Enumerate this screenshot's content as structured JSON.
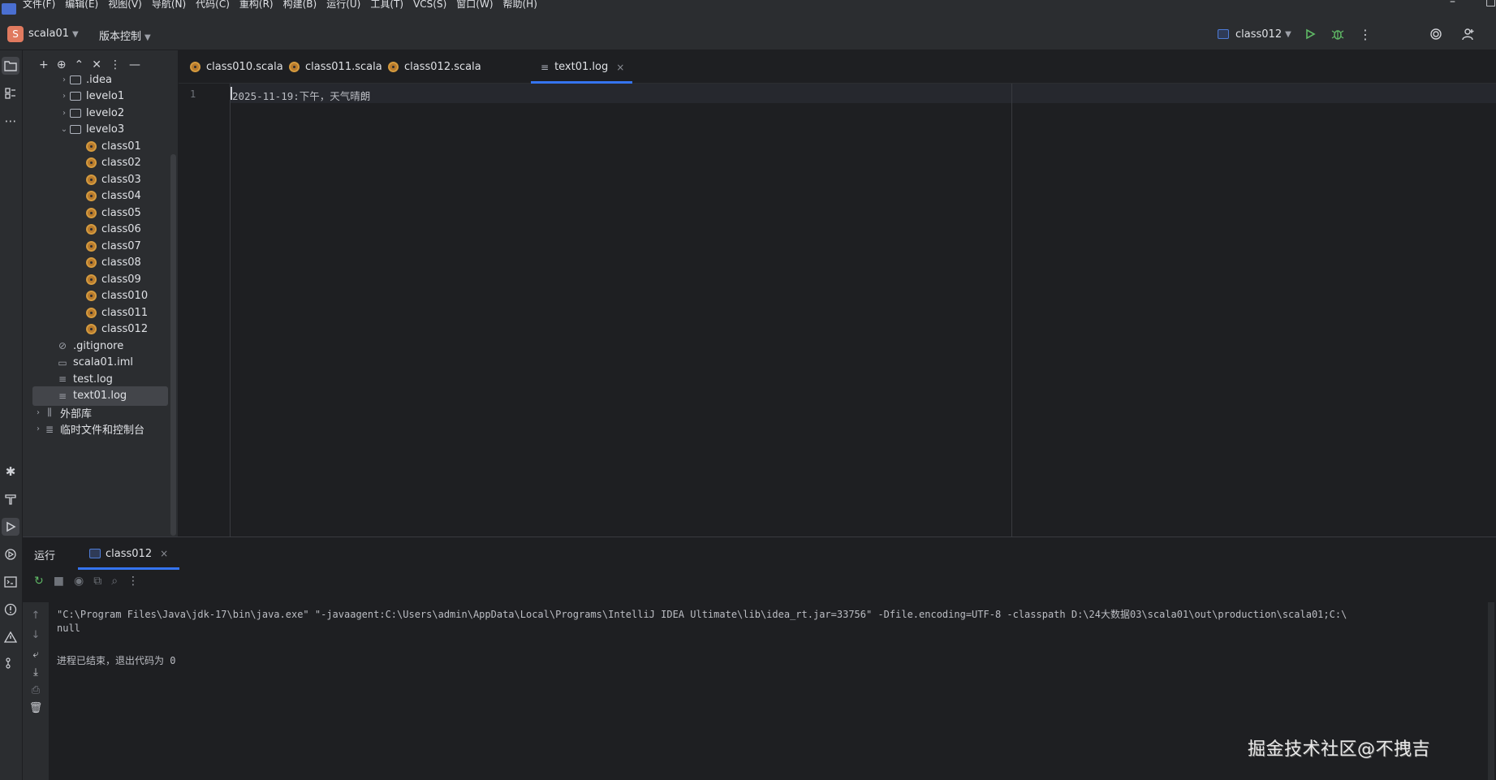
{
  "menu": [
    "文件(F)",
    "编辑(E)",
    "视图(V)",
    "导航(N)",
    "代码(C)",
    "重构(R)",
    "构建(B)",
    "运行(U)",
    "工具(T)",
    "VCS(S)",
    "窗口(W)",
    "帮助(H)"
  ],
  "toolbar": {
    "project_badge": "S",
    "project_name": "scala01",
    "vcs_label": "版本控制",
    "run_config": "class012",
    "icons": [
      "run-icon",
      "debug-icon",
      "more-icon",
      "ai-icon",
      "add-user-icon"
    ]
  },
  "project_tree": {
    "items": [
      {
        "label": ".idea",
        "indent": 1,
        "kind": "folder",
        "expanded": false
      },
      {
        "label": "levelo1",
        "indent": 1,
        "kind": "package",
        "expanded": false
      },
      {
        "label": "levelo2",
        "indent": 1,
        "kind": "package",
        "expanded": false
      },
      {
        "label": "levelo3",
        "indent": 1,
        "kind": "package",
        "expanded": true
      },
      {
        "label": "class01",
        "indent": 2,
        "kind": "scala"
      },
      {
        "label": "class02",
        "indent": 2,
        "kind": "scala"
      },
      {
        "label": "class03",
        "indent": 2,
        "kind": "scala"
      },
      {
        "label": "class04",
        "indent": 2,
        "kind": "scala"
      },
      {
        "label": "class05",
        "indent": 2,
        "kind": "scala"
      },
      {
        "label": "class06",
        "indent": 2,
        "kind": "scala"
      },
      {
        "label": "class07",
        "indent": 2,
        "kind": "scala"
      },
      {
        "label": "class08",
        "indent": 2,
        "kind": "scala"
      },
      {
        "label": "class09",
        "indent": 2,
        "kind": "scala"
      },
      {
        "label": "class010",
        "indent": 2,
        "kind": "scala"
      },
      {
        "label": "class011",
        "indent": 2,
        "kind": "scala"
      },
      {
        "label": "class012",
        "indent": 2,
        "kind": "scala"
      },
      {
        "label": ".gitignore",
        "indent": 0,
        "kind": "ignore"
      },
      {
        "label": "scala01.iml",
        "indent": 0,
        "kind": "iml"
      },
      {
        "label": "test.log",
        "indent": 0,
        "kind": "log"
      },
      {
        "label": "text01.log",
        "indent": 0,
        "kind": "log",
        "selected": true
      },
      {
        "label": "外部库",
        "indent": -1,
        "kind": "library",
        "expanded": false
      },
      {
        "label": "临时文件和控制台",
        "indent": -1,
        "kind": "scratch",
        "expanded": false
      }
    ]
  },
  "tabs": [
    {
      "label": "class010.scala",
      "kind": "scala"
    },
    {
      "label": "class011.scala",
      "kind": "scala"
    },
    {
      "label": "class012.scala",
      "kind": "scala"
    },
    {
      "label": "text01.log",
      "kind": "log",
      "active": true,
      "close": "×"
    }
  ],
  "editor": {
    "line_number": "1",
    "line_text": "2025-11-19:下午，天气晴朗"
  },
  "run_panel": {
    "title": "运行",
    "tab_label": "class012",
    "tab_close": "×",
    "console": [
      "\"C:\\Program Files\\Java\\jdk-17\\bin\\java.exe\" \"-javaagent:C:\\Users\\admin\\AppData\\Local\\Programs\\IntelliJ IDEA Ultimate\\lib\\idea_rt.jar=33756\" -Dfile.encoding=UTF-8 -classpath D:\\24大数据03\\scala01\\out\\production\\scala01;C:\\",
      "null",
      "",
      "进程已结束，退出代码为 0"
    ]
  },
  "watermark": "掘金技术社区@不拽吉"
}
